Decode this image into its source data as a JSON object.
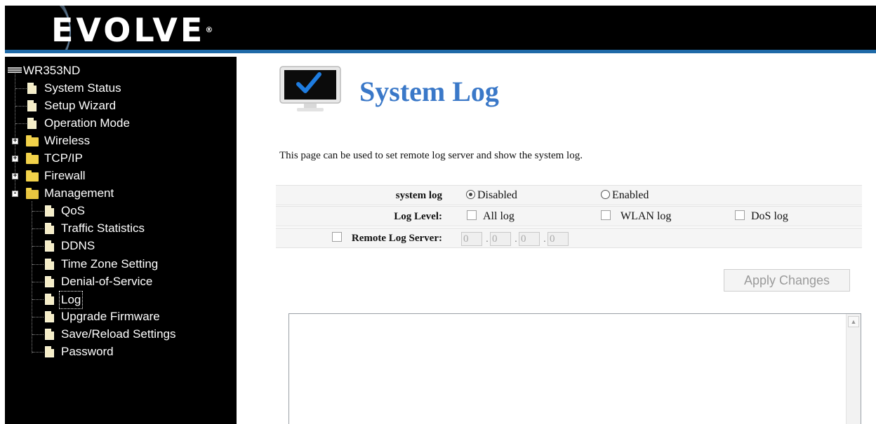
{
  "header": {
    "logo": "EVOLVE",
    "logo_mark": "®",
    "colors": {
      "background": "#000000",
      "accent_line": "#1f6aa8"
    }
  },
  "sidebar": {
    "root": {
      "label": "WR353ND",
      "icon": "router-icon"
    },
    "items": [
      {
        "label": "System Status",
        "icon": "document-icon"
      },
      {
        "label": "Setup Wizard",
        "icon": "document-icon"
      },
      {
        "label": "Operation Mode",
        "icon": "document-icon"
      },
      {
        "label": "Wireless",
        "icon": "folder-icon",
        "expander": "+"
      },
      {
        "label": "TCP/IP",
        "icon": "folder-icon",
        "expander": "+"
      },
      {
        "label": "Firewall",
        "icon": "folder-icon",
        "expander": "+"
      },
      {
        "label": "Management",
        "icon": "folder-open-icon",
        "expander": "-"
      }
    ],
    "management_items": [
      {
        "label": "QoS"
      },
      {
        "label": "Traffic Statistics"
      },
      {
        "label": "DDNS"
      },
      {
        "label": "Time Zone Setting"
      },
      {
        "label": "Denial-of-Service"
      },
      {
        "label": "Log",
        "selected": true
      },
      {
        "label": "Upgrade Firmware"
      },
      {
        "label": "Save/Reload Settings"
      },
      {
        "label": "Password"
      }
    ]
  },
  "main": {
    "title": "System Log",
    "title_color": "#3a78c8",
    "icon": "monitor-checkmark-icon",
    "description": "This page can be used to set remote log server and show the system log.",
    "form": {
      "system_log": {
        "label": "system log",
        "options": [
          "Disabled",
          "Enabled"
        ],
        "selected": "Disabled"
      },
      "log_level": {
        "label": "Log Level:",
        "options": [
          "All log",
          "WLAN log",
          "DoS log"
        ],
        "checked": []
      },
      "remote_log_server": {
        "label": "Remote Log Server:",
        "checked": false,
        "ip": [
          "0",
          "0",
          "0",
          "0"
        ]
      }
    },
    "apply_button": "Apply Changes",
    "log_content": ""
  }
}
